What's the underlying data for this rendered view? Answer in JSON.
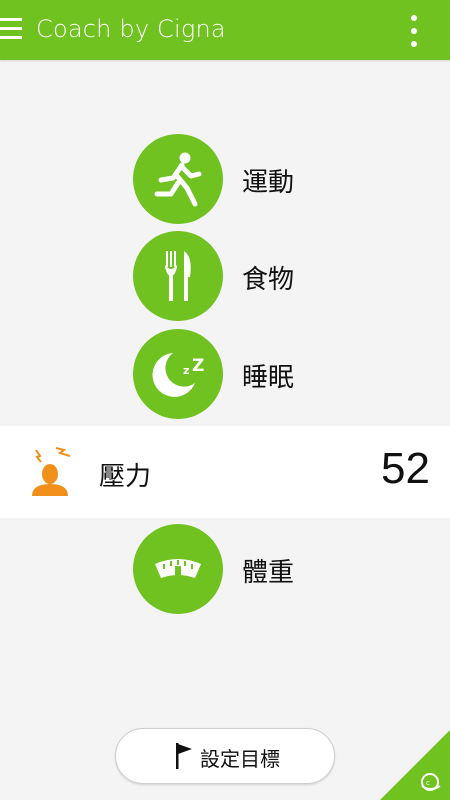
{
  "appbar": {
    "title": "Coach by Cigna",
    "menu_icon": "hamburger-menu-icon",
    "overflow_icon": "more-vert-icon"
  },
  "categories": [
    {
      "label": "運動",
      "icon": "running-icon"
    },
    {
      "label": "食物",
      "icon": "fork-knife-icon"
    },
    {
      "label": "睡眠",
      "icon": "moon-zzz-icon"
    }
  ],
  "stress": {
    "label": "壓力",
    "score": "52",
    "icon": "stressed-person-icon"
  },
  "weight": {
    "label": "體重",
    "icon": "scale-icon"
  },
  "goal_button": {
    "label": "設定目標",
    "icon": "flag-icon"
  },
  "corner_badge": {
    "icon": "coach-cap-icon"
  },
  "colors": {
    "primary_green": "#6fc21f",
    "stress_orange": "#f0901a",
    "background": "#f4f4f4"
  }
}
